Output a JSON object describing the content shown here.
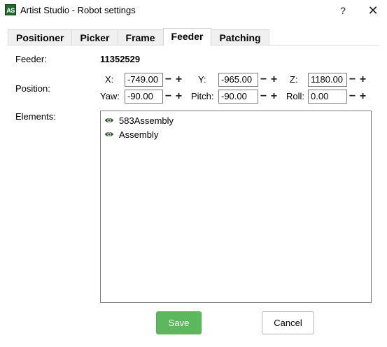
{
  "window": {
    "app_icon_text": "AS",
    "title": "Artist Studio - Robot settings",
    "help_label": "?",
    "close_label": "✕"
  },
  "tabs": [
    {
      "label": "Positioner",
      "active": false
    },
    {
      "label": "Picker",
      "active": false
    },
    {
      "label": "Frame",
      "active": false
    },
    {
      "label": "Feeder",
      "active": true
    },
    {
      "label": "Patching",
      "active": false
    }
  ],
  "form": {
    "feeder_label": "Feeder:",
    "feeder_value": "11352529",
    "position_label": "Position:",
    "elements_label": "Elements:",
    "x": {
      "label": "X:",
      "value": "-749.00"
    },
    "y": {
      "label": "Y:",
      "value": "-965.00"
    },
    "z": {
      "label": "Z:",
      "value": "1180.00"
    },
    "yaw": {
      "label": "Yaw:",
      "value": "-90.00"
    },
    "pitch": {
      "label": "Pitch:",
      "value": "-90.00"
    },
    "roll": {
      "label": "Roll:",
      "value": "0.00"
    },
    "minus": "−",
    "plus": "+"
  },
  "elements": [
    {
      "label": "583Assembly",
      "icon": "eye-icon"
    },
    {
      "label": "Assembly",
      "icon": "eye-icon"
    }
  ],
  "buttons": {
    "save": "Save",
    "cancel": "Cancel"
  },
  "colors": {
    "save_bg": "#5cb85c",
    "eye": "#2e5a2e",
    "app_icon": "#1f6b2a"
  }
}
